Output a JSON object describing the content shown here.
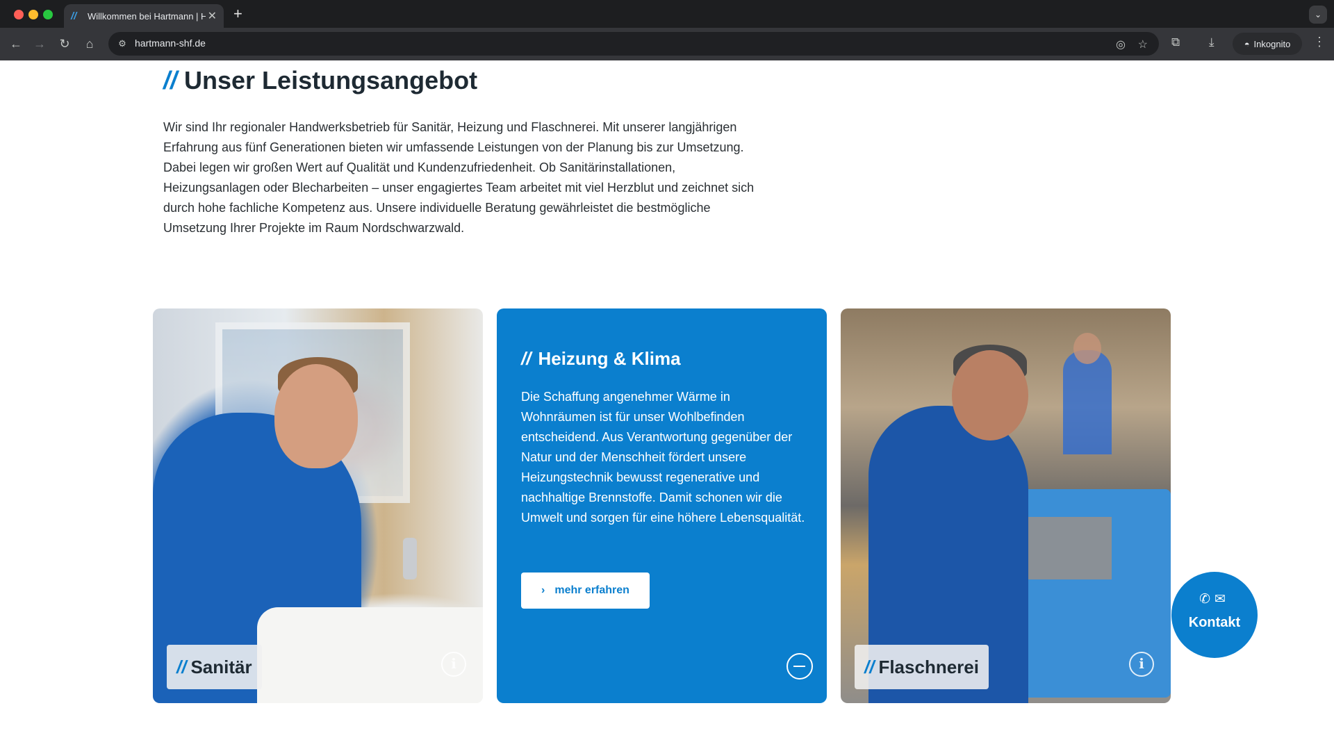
{
  "browser": {
    "tab_title": "Willkommen bei Hartmann | Hartmann SHF",
    "tab_favicon": "//",
    "new_tab": "+",
    "url": "hartmann-shf.de",
    "incognito_label": "Inkognito"
  },
  "section": {
    "title": "Unser Leistungsangebot",
    "slashes": "//",
    "intro": "Wir sind Ihr regionaler Handwerksbetrieb für Sanitär, Heizung und Flaschnerei. Mit unserer langjährigen Erfahrung aus fünf Generationen bieten wir umfassende Leistungen von der Planung bis zur Umsetzung. Dabei legen wir großen Wert auf Qualität und Kundenzufriedenheit. Ob Sanitärinstallationen, Heizungsanlagen oder Blecharbeiten – unser engagiertes Team arbeitet mit viel Herzblut und zeichnet sich durch hohe fachliche Kompetenz aus. Unsere individuelle Beratung gewährleistet die bestmögliche Umsetzung Ihrer Projekte im Raum Nordschwarzwald."
  },
  "cards": [
    {
      "label": "Sanitär",
      "slashes": "//",
      "info_icon": "i"
    },
    {
      "title": "Heizung & Klima",
      "slashes": "//",
      "text": "Die Schaffung angenehmer Wärme in Wohnräumen ist für unser Wohlbefinden entscheidend. Aus Verantwortung gegenüber der Natur und der Menschheit fördert unsere Heizungstechnik bewusst regenerative und nachhaltige Brennstoffe. Damit schonen wir die Umwelt und sorgen für eine höhere Lebensqualität.",
      "button_label": "mehr erfahren"
    },
    {
      "label": "Flaschnerei",
      "slashes": "//",
      "info_icon": "i"
    }
  ],
  "kontakt": {
    "label": "Kontakt",
    "icons": "✆✉"
  },
  "colors": {
    "brand_blue": "#0b7fce",
    "heading": "#1e2a33"
  }
}
